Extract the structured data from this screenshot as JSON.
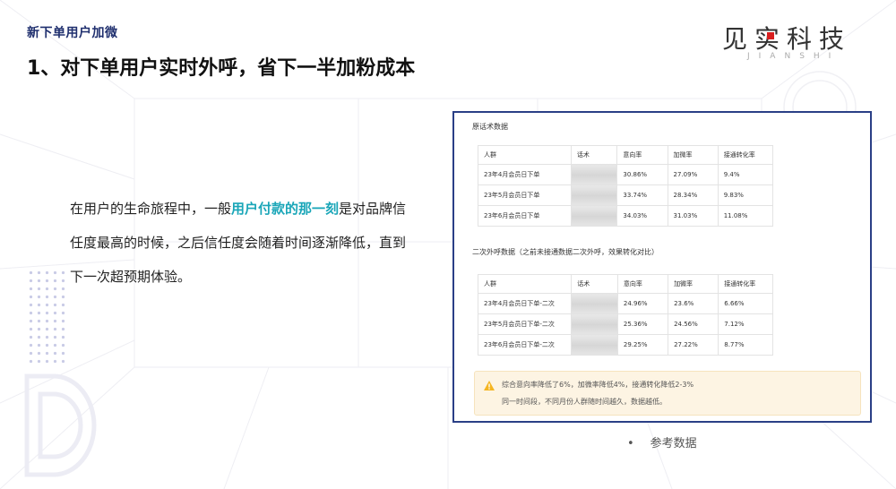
{
  "header": {
    "section_tag": "新下单用户加微",
    "title": "1、对下单用户实时外呼，省下一半加粉成本"
  },
  "logo": {
    "text": "见实科技",
    "subtext": "JIANSHI"
  },
  "body": {
    "part1": "在用户的生命旅程中，一般",
    "highlight": "用户付款的那一刻",
    "part2": "是对品牌信任度最高的时候，之后信任度会随着时间逐渐降低，直到下一次超预期体验。"
  },
  "panel": {
    "table1": {
      "caption": "原话术数据",
      "headers": [
        "人群",
        "话术",
        "意向率",
        "加微率",
        "接通转化率"
      ],
      "rows": [
        [
          "23年4月会员日下单",
          "",
          "30.86%",
          "27.09%",
          "9.4%"
        ],
        [
          "23年5月会员日下单",
          "",
          "33.74%",
          "28.34%",
          "9.83%"
        ],
        [
          "23年6月会员日下单",
          "",
          "34.03%",
          "31.03%",
          "11.08%"
        ]
      ]
    },
    "table2": {
      "caption": "二次外呼数据（之前未接通数据二次外呼，效果转化对比）",
      "headers": [
        "人群",
        "话术",
        "意向率",
        "加微率",
        "接通转化率"
      ],
      "rows": [
        [
          "23年4月会员日下单-二次",
          "",
          "24.96%",
          "23.6%",
          "6.66%"
        ],
        [
          "23年5月会员日下单-二次",
          "",
          "25.36%",
          "24.56%",
          "7.12%"
        ],
        [
          "23年6月会员日下单-二次",
          "",
          "29.25%",
          "27.22%",
          "8.77%"
        ]
      ]
    },
    "note": {
      "line1": "综合意向率降低了6%，加微率降低4%，接通转化降低2-3%",
      "line2": "同一时间段，不同月份人群随时间越久，数据越低。"
    }
  },
  "footer": {
    "bullet": "•",
    "caption": "参考数据"
  },
  "colors": {
    "title_navy": "#1f2f6e",
    "highlight": "#1aa6b8",
    "panel_border": "#2a3f86",
    "note_bg": "#fdf4e3",
    "logo_red": "#d81e1e"
  }
}
